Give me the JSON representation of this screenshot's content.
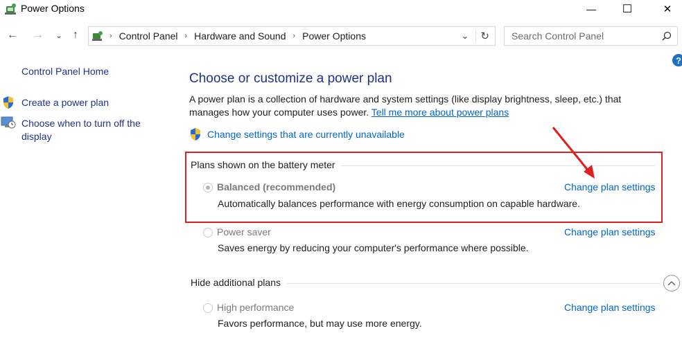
{
  "window": {
    "title": "Power Options",
    "controls": {
      "minimize": "—",
      "maximize": "☐",
      "close": "✕"
    }
  },
  "nav": {
    "back_icon": "←",
    "forward_icon": "→",
    "recent_icon": "⌄",
    "up_icon": "↑",
    "breadcrumbs": [
      "Control Panel",
      "Hardware and Sound",
      "Power Options"
    ],
    "separator": "›",
    "dropdown_icon": "⌄",
    "refresh_icon": "↻",
    "search_placeholder": "Search Control Panel",
    "search_icon": "⚲"
  },
  "help_label": "?",
  "sidebar": {
    "home": "Control Panel Home",
    "items": [
      {
        "label": "Create a power plan",
        "icon": "shield-icon"
      },
      {
        "label": "Choose when to turn off the display",
        "icon": "monitor-clock-icon"
      }
    ]
  },
  "main": {
    "heading": "Choose or customize a power plan",
    "description": "A power plan is a collection of hardware and system settings (like display brightness, sleep, etc.) that manages how your computer uses power.",
    "learn_more": "Tell me more about power plans",
    "change_unavailable": "Change settings that are currently unavailable",
    "battery_group_label": "Plans shown on the battery meter",
    "hidden_group_label": "Hide additional plans",
    "plans": [
      {
        "name": "Balanced (recommended)",
        "description": "Automatically balances performance with energy consumption on capable hardware.",
        "selected": true,
        "link": "Change plan settings"
      },
      {
        "name": "Power saver",
        "description": "Saves energy by reducing your computer's performance where possible.",
        "selected": false,
        "link": "Change plan settings"
      },
      {
        "name": "High performance",
        "description": "Favors performance, but may use more energy.",
        "selected": false,
        "link": "Change plan settings"
      }
    ]
  },
  "colors": {
    "highlight": "#e02020",
    "link": "#0066cc",
    "heading": "#1e3287"
  }
}
